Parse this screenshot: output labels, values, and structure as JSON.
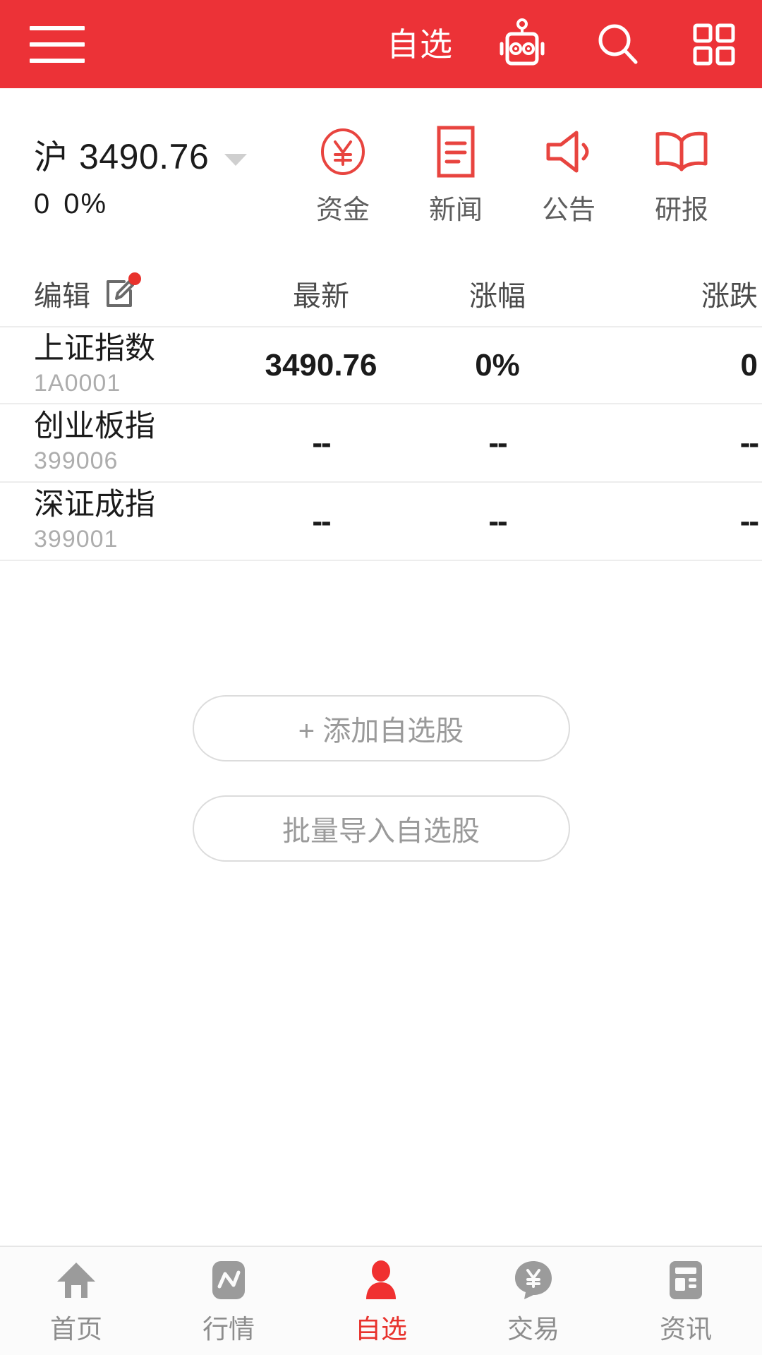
{
  "theme": {
    "header_bg": "#ec3237",
    "accent_red": "#e8322c",
    "text_dark": "#1b1b1b",
    "text_muted": "#8d8d8d",
    "code_gray": "#adadad",
    "border": "#ededed"
  },
  "header": {
    "menu_icon": "hamburger-menu-icon",
    "title": "自选",
    "robot_icon": "robot-icon",
    "search_icon": "search-icon",
    "grid_icon": "grid-apps-icon"
  },
  "summary": {
    "index_label": "沪",
    "index_value": "3490.76",
    "dropdown_icon": "chevron-down-icon",
    "change_value": "0",
    "change_percent": "0%"
  },
  "quick_actions": [
    {
      "label": "资金",
      "icon": "yen-circle-icon"
    },
    {
      "label": "新闻",
      "icon": "document-lines-icon"
    },
    {
      "label": "公告",
      "icon": "speaker-announce-icon"
    },
    {
      "label": "研报",
      "icon": "open-book-icon"
    }
  ],
  "table": {
    "headers": {
      "edit": "编辑",
      "edit_icon": "edit-pencil-icon",
      "latest": "最新",
      "change_pct": "涨幅",
      "change_amt": "涨跌"
    },
    "rows": [
      {
        "name": "上证指数",
        "code": "1A0001",
        "latest": "3490.76",
        "change_pct": "0%",
        "change_amt": "0"
      },
      {
        "name": "创业板指",
        "code": "399006",
        "latest": "--",
        "change_pct": "--",
        "change_amt": "--"
      },
      {
        "name": "深证成指",
        "code": "399001",
        "latest": "--",
        "change_pct": "--",
        "change_amt": "--"
      }
    ]
  },
  "actions": {
    "add_stock": "+ 添加自选股",
    "batch_import": "批量导入自选股"
  },
  "bottom_nav": [
    {
      "label": "首页",
      "icon": "home-icon",
      "active": false
    },
    {
      "label": "行情",
      "icon": "market-chart-icon",
      "active": false
    },
    {
      "label": "自选",
      "icon": "person-icon",
      "active": true
    },
    {
      "label": "交易",
      "icon": "trade-yen-bubble-icon",
      "active": false
    },
    {
      "label": "资讯",
      "icon": "news-card-icon",
      "active": false
    }
  ]
}
